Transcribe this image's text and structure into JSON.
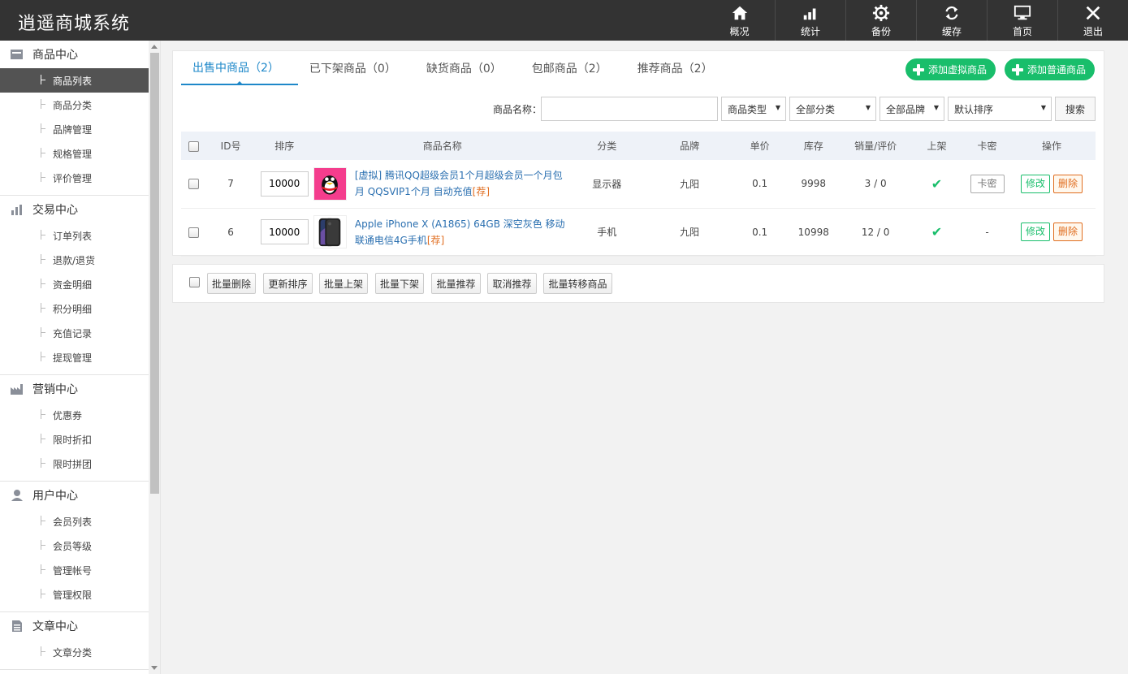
{
  "app": {
    "title": "逍遥商城系统"
  },
  "topnav": [
    {
      "label": "概况",
      "icon": "home-icon"
    },
    {
      "label": "统计",
      "icon": "bar-chart-icon"
    },
    {
      "label": "备份",
      "icon": "gear-icon"
    },
    {
      "label": "缓存",
      "icon": "refresh-icon"
    },
    {
      "label": "首页",
      "icon": "monitor-icon"
    },
    {
      "label": "退出",
      "icon": "close-icon"
    }
  ],
  "sidebar": {
    "groups": [
      {
        "title": "商品中心",
        "icon": "box-icon",
        "items": [
          "商品列表",
          "商品分类",
          "品牌管理",
          "规格管理",
          "评价管理"
        ]
      },
      {
        "title": "交易中心",
        "icon": "bar-chart-icon",
        "items": [
          "订单列表",
          "退款/退货",
          "资金明细",
          "积分明细",
          "充值记录",
          "提现管理"
        ]
      },
      {
        "title": "营销中心",
        "icon": "factory-icon",
        "items": [
          "优惠券",
          "限时折扣",
          "限时拼团"
        ]
      },
      {
        "title": "用户中心",
        "icon": "user-icon",
        "items": [
          "会员列表",
          "会员等级",
          "管理帐号",
          "管理权限"
        ]
      },
      {
        "title": "文章中心",
        "icon": "document-icon",
        "items": [
          "文章分类"
        ]
      }
    ],
    "active_item": "商品列表"
  },
  "tabs": [
    "出售中商品（2）",
    "已下架商品（0）",
    "缺货商品（0）",
    "包邮商品（2）",
    "推荐商品（2）"
  ],
  "actions": {
    "add_virtual": "添加虚拟商品",
    "add_normal": "添加普通商品"
  },
  "search": {
    "name_label": "商品名称：",
    "name_value": "",
    "type_select": "商品类型",
    "category_select": "全部分类",
    "brand_select": "全部品牌",
    "sort_select": "默认排序",
    "button": "搜索"
  },
  "table": {
    "headers": [
      "ID号",
      "排序",
      "商品名称",
      "分类",
      "品牌",
      "单价",
      "库存",
      "销量/评价",
      "上架",
      "卡密",
      "操作"
    ],
    "rows": [
      {
        "id": "7",
        "sort": "10000",
        "name": "[虚拟] 腾讯QQ超级会员1个月超级会员一个月包月 QQSVIP1个月 自动充值",
        "tag": "[荐]",
        "category": "显示器",
        "brand": "九阳",
        "price": "0.1",
        "stock": "9998",
        "sales": "3 / 0",
        "on_shelf": "✔",
        "card": "卡密",
        "edit": "修改",
        "delete": "删除"
      },
      {
        "id": "6",
        "sort": "10000",
        "name": "Apple iPhone X (A1865) 64GB 深空灰色 移动联通电信4G手机",
        "tag": "[荐]",
        "category": "手机",
        "brand": "九阳",
        "price": "0.1",
        "stock": "10998",
        "sales": "12 / 0",
        "on_shelf": "✔",
        "card": "-",
        "edit": "修改",
        "delete": "删除"
      }
    ]
  },
  "bulk": [
    "批量删除",
    "更新排序",
    "批量上架",
    "批量下架",
    "批量推荐",
    "取消推荐",
    "批量转移商品"
  ],
  "colors": {
    "header_bg": "#333333",
    "accent": "#1e88c9",
    "green": "#19be6b",
    "orange": "#e06d1f"
  }
}
